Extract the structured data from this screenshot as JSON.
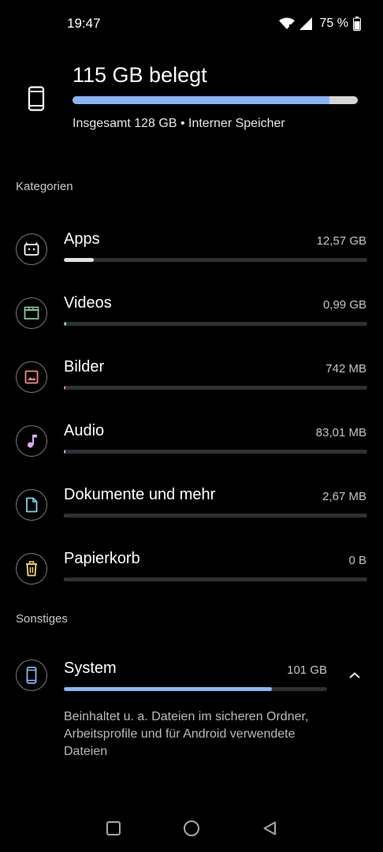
{
  "status_bar": {
    "time": "19:47",
    "battery": "75 %"
  },
  "storage": {
    "used_label": "115 GB belegt",
    "used_fraction": 0.9,
    "total_label": "Insgesamt 128 GB • Interner Speicher"
  },
  "sections": {
    "categories": "Kategorien",
    "other": "Sonstiges"
  },
  "categories": [
    {
      "name": "Apps",
      "size": "12,57 GB",
      "icon": "android-apps-icon",
      "color": "#e0e0e0",
      "fraction": 0.098
    },
    {
      "name": "Videos",
      "size": "0,99 GB",
      "icon": "clapperboard-icon",
      "color": "#81c995",
      "fraction": 0.008
    },
    {
      "name": "Bilder",
      "size": "742 MB",
      "icon": "image-icon",
      "color": "#f28b82",
      "fraction": 0.006
    },
    {
      "name": "Audio",
      "size": "83,01 MB",
      "icon": "music-note-icon",
      "color": "#d7aefb",
      "fraction": 0.001
    },
    {
      "name": "Dokumente und mehr",
      "size": "2,67 MB",
      "icon": "document-icon",
      "color": "#78d9ec",
      "fraction": 0.0
    },
    {
      "name": "Papierkorb",
      "size": "0 B",
      "icon": "trash-icon",
      "color": "#fdd663",
      "fraction": 0.0
    }
  ],
  "system": {
    "name": "System",
    "size": "101 GB",
    "icon": "phone-icon",
    "color": "#8ab4f8",
    "fraction": 0.79,
    "description": "Beinhaltet u. a. Dateien im sicheren Ordner, Arbeitsprofile und für Android verwendete Dateien"
  },
  "nav": {
    "items": [
      "recents-icon",
      "home-icon",
      "back-icon"
    ]
  }
}
